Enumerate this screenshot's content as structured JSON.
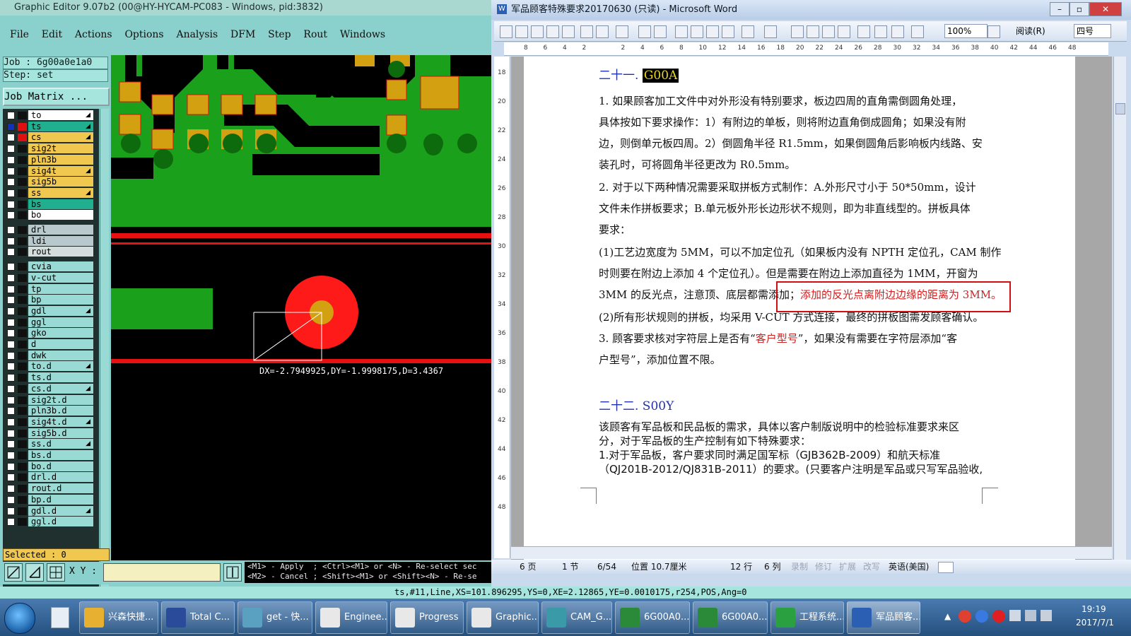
{
  "graphic_editor": {
    "title": "Graphic Editor 9.07b2 (00@HY-HYCAM-PC083 - Windows, pid:3832)",
    "menu": [
      "File",
      "Edit",
      "Actions",
      "Options",
      "Analysis",
      "DFM",
      "Step",
      "Rout",
      "Windows"
    ],
    "job": "Job : 6g00a0e1a0",
    "step": "Step: set",
    "job_matrix": "Job Matrix ...",
    "layers": [
      {
        "name": "to",
        "color": "#ffffff",
        "swatch": "#101010",
        "arrow": true
      },
      {
        "name": "ts",
        "color": "#20b090",
        "swatch": "#e01010",
        "arrow": true,
        "checked_color": "#1030c0"
      },
      {
        "name": "cs",
        "color": "#f0c850",
        "swatch": "#e01010",
        "arrow": true
      },
      {
        "name": "sig2t",
        "color": "#f0c850",
        "swatch": "#101010",
        "arrow": false
      },
      {
        "name": "pln3b",
        "color": "#f0c850",
        "swatch": "#101010",
        "arrow": false
      },
      {
        "name": "sig4t",
        "color": "#f0c850",
        "swatch": "#101010",
        "arrow": true
      },
      {
        "name": "sig5b",
        "color": "#f0c850",
        "swatch": "#101010",
        "arrow": false
      },
      {
        "name": "ss",
        "color": "#f0c850",
        "swatch": "#101010",
        "arrow": true
      },
      {
        "name": "bs",
        "color": "#20b090",
        "swatch": "#101010",
        "arrow": false
      },
      {
        "name": "bo",
        "color": "#ffffff",
        "swatch": "#101010",
        "arrow": false
      },
      {
        "name": "drl",
        "color": "#b8c8cc",
        "swatch": "#101010",
        "arrow": false
      },
      {
        "name": "ldi",
        "color": "#b8c8cc",
        "swatch": "#101010",
        "arrow": false
      },
      {
        "name": "rout",
        "color": "#d4dcdc",
        "swatch": "#101010",
        "arrow": false
      },
      {
        "name": "cvia",
        "color": "#9adad4",
        "swatch": "#101010",
        "arrow": false
      },
      {
        "name": "v-cut",
        "color": "#9adad4",
        "swatch": "#101010",
        "arrow": false
      },
      {
        "name": "tp",
        "color": "#9adad4",
        "swatch": "#101010",
        "arrow": false
      },
      {
        "name": "bp",
        "color": "#9adad4",
        "swatch": "#101010",
        "arrow": false
      },
      {
        "name": "gdl",
        "color": "#9adad4",
        "swatch": "#101010",
        "arrow": true
      },
      {
        "name": "ggl",
        "color": "#9adad4",
        "swatch": "#101010",
        "arrow": false
      },
      {
        "name": "gko",
        "color": "#9adad4",
        "swatch": "#101010",
        "arrow": false
      },
      {
        "name": "d",
        "color": "#9adad4",
        "swatch": "#101010",
        "arrow": false
      },
      {
        "name": "dwk",
        "color": "#9adad4",
        "swatch": "#101010",
        "arrow": false
      },
      {
        "name": "to.d",
        "color": "#9adad4",
        "swatch": "#101010",
        "arrow": true
      },
      {
        "name": "ts.d",
        "color": "#9adad4",
        "swatch": "#101010",
        "arrow": false
      },
      {
        "name": "cs.d",
        "color": "#9adad4",
        "swatch": "#101010",
        "arrow": true
      },
      {
        "name": "sig2t.d",
        "color": "#9adad4",
        "swatch": "#101010",
        "arrow": false
      },
      {
        "name": "pln3b.d",
        "color": "#9adad4",
        "swatch": "#101010",
        "arrow": false
      },
      {
        "name": "sig4t.d",
        "color": "#9adad4",
        "swatch": "#101010",
        "arrow": true
      },
      {
        "name": "sig5b.d",
        "color": "#9adad4",
        "swatch": "#101010",
        "arrow": false
      },
      {
        "name": "ss.d",
        "color": "#9adad4",
        "swatch": "#101010",
        "arrow": true
      },
      {
        "name": "bs.d",
        "color": "#9adad4",
        "swatch": "#101010",
        "arrow": false
      },
      {
        "name": "bo.d",
        "color": "#9adad4",
        "swatch": "#101010",
        "arrow": false
      },
      {
        "name": "drl.d",
        "color": "#9adad4",
        "swatch": "#101010",
        "arrow": false
      },
      {
        "name": "rout.d",
        "color": "#9adad4",
        "swatch": "#101010",
        "arrow": false
      },
      {
        "name": "bp.d",
        "color": "#9adad4",
        "swatch": "#101010",
        "arrow": false
      },
      {
        "name": "gdl.d",
        "color": "#9adad4",
        "swatch": "#101010",
        "arrow": true
      },
      {
        "name": "ggl.d",
        "color": "#9adad4",
        "swatch": "#101010",
        "arrow": false
      }
    ],
    "selected": "Selected : 0",
    "measure": "DX=-2.7949925,DY=-1.9998175,D=3.4367",
    "xy_label": "X Y :",
    "hint_line1": "<M1> - Apply  ; <Ctrl><M1> or <N> - Re-select sec",
    "hint_line2": "<M2> - Cancel ; <Shift><M1> or <Shift><N> - Re-se",
    "status": "ts,#11,Line,XS=101.896295,YS=0,XE=2.12865,YE=0.0010175,r254,POS,Ang=0"
  },
  "word": {
    "title": "军品顾客特殊要求20170630 (只读) - Microsoft Word",
    "zoom": "100%",
    "read_button": "阅读(R)",
    "font_size": "四号",
    "ruler_marks": [
      "8",
      "6",
      "4",
      "2",
      "",
      "2",
      "4",
      "6",
      "8",
      "10",
      "12",
      "14",
      "16",
      "18",
      "20",
      "22",
      "24",
      "26",
      "28",
      "30",
      "32",
      "34",
      "36",
      "38",
      "40",
      "42",
      "44",
      "46",
      "48"
    ],
    "vruler_marks": [
      "18",
      "20",
      "22",
      "24",
      "26",
      "28",
      "30",
      "32",
      "34",
      "36",
      "38",
      "40",
      "42",
      "44",
      "46",
      "48"
    ],
    "heading1_prefix": "二十一.",
    "heading1_code": "G00A",
    "para": [
      "1. 如果顾客加工文件中对外形没有特别要求，板边四周的直角需倒圆角处理，",
      "具体按如下要求操作：1）有附边的单板，则将附边直角倒成圆角；如果没有附",
      "边，则倒单元板四周。2）倒圆角半径 R1.5mm，如果倒圆角后影响板内线路、安",
      "装孔时，可将圆角半径更改为 R0.5mm。",
      "2. 对于以下两种情况需要采取拼板方式制作：A.外形尺寸小于 50*50mm，设计",
      "文件未作拼板要求；B.单元板外形长边形状不规则，即为非直线型的。拼板具体",
      "要求：",
      "(1)工艺边宽度为 5MM，可以不加定位孔（如果板内没有 NPTH 定位孔，CAM 制作",
      "时则要在附边上添加 4 个定位孔）。但是需要在附边上添加直径为 1MM，开窗为",
      "3MM 的反光点，注意顶、底层都需添加；",
      "添加的反光点离附边边缘的距离为 3MM。",
      "(2)所有形状规则的拼板，均采用 V-CUT 方式连接，最终的拼板图需发顾客确认。",
      "3. 顾客要求核对字符层上是否有“",
      "客户型号",
      "”，如果没有需要在字符层添加“客",
      "户型号”，添加位置不限。"
    ],
    "heading2": "二十二. S00Y",
    "para2": [
      "该顾客有军品板和民品板的需求，具体以客户制版说明中的检验标准要求来区",
      "分，对于军品板的生产控制有如下特殊要求：",
      "1.对于军品板，客户要求同时满足国军标（GJB362B-2009）和航天标准",
      "（QJ201B-2012/QJ831B-2011）的要求。(只要客户注明是军品或只写军品验收,"
    ],
    "status": {
      "page": "6 页",
      "section": "1 节",
      "page_of": "6/54",
      "position": "位置 10.7厘米",
      "line": "12 行",
      "column": "6 列",
      "rec": "录制",
      "trk": "修订",
      "ext": "扩展",
      "ovr": "改写",
      "lang": "英语(美国)"
    }
  },
  "taskbar": {
    "items": [
      "兴森快捷...",
      "Total C...",
      "get - 快...",
      "Enginee...",
      "Progress",
      "Graphic...",
      "CAM_G...",
      "6G00A0...",
      "6G00A0...",
      "工程系统...",
      "军品顾客..."
    ],
    "time": "19:19",
    "date": "2017/7/1"
  },
  "colors": {
    "board_green": "#1aa01a",
    "pad_orange": "#d2a010",
    "trace_red": "#e81010",
    "pad_red": "#ff1a1a",
    "annotation_red": "#d01010"
  }
}
